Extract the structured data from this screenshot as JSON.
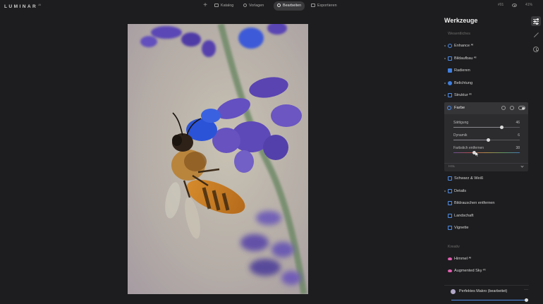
{
  "app": {
    "logo": "LUMINAR",
    "logo_suffix": "AI"
  },
  "nav": {
    "tabs": [
      {
        "label": "Katalog",
        "icon": "folder-icon",
        "active": false
      },
      {
        "label": "Vorlagen",
        "icon": "search-icon",
        "active": false
      },
      {
        "label": "Bearbeiten",
        "icon": "edit-icon",
        "active": true
      },
      {
        "label": "Exportieren",
        "icon": "export-icon",
        "active": false
      }
    ],
    "top_right": {
      "badge": "#01",
      "zoom": "41%"
    }
  },
  "panel": {
    "title": "Werkzeuge",
    "sections": {
      "essentials": "Wesentliches",
      "creative": "Kreativ"
    },
    "tools_top": [
      {
        "label": "Enhance ᴬᴵ",
        "icon": "enhance-icon"
      },
      {
        "label": "Bildaufbau ᴬᴵ",
        "icon": "crop-icon"
      },
      {
        "label": "Radieren",
        "icon": "eraser-icon"
      },
      {
        "label": "Belichtung",
        "icon": "exposure-icon"
      },
      {
        "label": "Struktur ᴬᴵ",
        "icon": "structure-icon"
      }
    ],
    "farbe": {
      "label": "Farbe",
      "sliders": [
        {
          "label": "Sättigung",
          "value": "46",
          "fraction": 0.73
        },
        {
          "label": "Dynamik",
          "value": "6",
          "fraction": 0.53
        },
        {
          "label": "Farbstich entfernen",
          "value": "38",
          "fraction": 0.31
        }
      ],
      "hsl_label": "HSL"
    },
    "tools_bottom": [
      {
        "label": "Schwarz & Weiß",
        "icon": "bw-icon"
      },
      {
        "label": "Details",
        "icon": "details-icon"
      },
      {
        "label": "Bildrauschen entfernen",
        "icon": "denoise-icon"
      },
      {
        "label": "Landschaft",
        "icon": "landscape-icon"
      },
      {
        "label": "Vignette",
        "icon": "vignette-icon"
      }
    ],
    "tools_creative": [
      {
        "label": "Himmel ᴬᴵ",
        "icon": "sky-icon"
      },
      {
        "label": "Augmented Sky ᴬᴵ",
        "icon": "augmented-sky-icon"
      }
    ],
    "preset": {
      "label": "Perfektes Makro (bearbeitet)",
      "more": "···",
      "amount": 1.0
    }
  },
  "colors": {
    "accent": "#3f7fe0",
    "panel_bg": "#1d1d1f",
    "card_bg": "#2c2c2f",
    "creative_pink": "#e05fb0"
  }
}
